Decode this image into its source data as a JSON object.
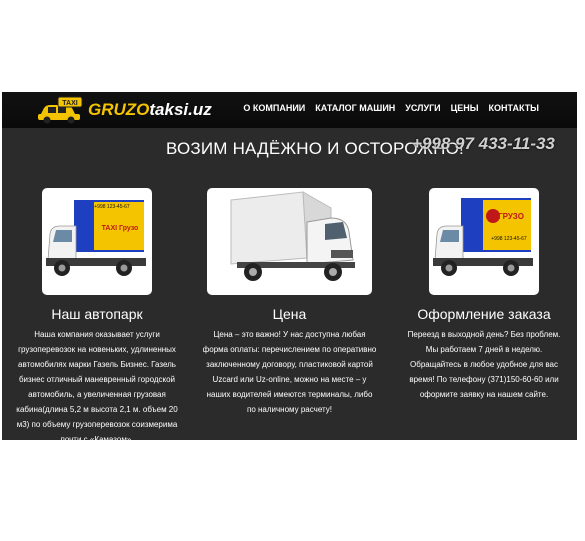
{
  "header": {
    "logo_badge": "TAXI",
    "brand_part1": "GRUZO",
    "brand_part2": "taksi.uz",
    "nav": [
      "О КОМПАНИИ",
      "КАТАЛОГ МАШИН",
      "УСЛУГИ",
      "ЦЕНЫ",
      "КОНТАКТЫ"
    ]
  },
  "banner": {
    "headline": "ВОЗИМ НАДЁЖНО И ОСТОРОЖНО!",
    "phone": "+998 97 433-11-33"
  },
  "cards": [
    {
      "title": "Наш автопарк",
      "body": "Наша компания оказывает услуги грузоперевозок на новеньких, удлиненных автомобилях марки Газель Бизнес. Газель бизнес отличный маневренный городской автомобиль, а увеличенная грузовая кабина(длина 5,2 м высота 2,1 м. объем 20 м3) по объему грузоперевозок соизмерима почти с «Камазом».",
      "image_label": "TAXI Грузо",
      "image_phone": "+998 123-45-67",
      "image_kind": "yellow-gazelle-truck"
    },
    {
      "title": "Цена",
      "body": "Цена – это важно! У нас доступна любая форма оплаты: перечислением по оперативно заключенному договору, пластиковой картой Uzcard или Uz-online, можно на месте – у наших водителей имеются терминалы, либо по наличному расчету!",
      "image_kind": "white-box-truck"
    },
    {
      "title": "Оформление заказа",
      "body": "Переезд в выходной день? Без проблем. Мы работаем 7 дней в неделю. Обращайтесь в любое удобное для вас время! По телефону (371)150-60-60 или оформите заявку на нашем сайте.",
      "image_label": "ГРУЗО",
      "image_phone": "+998 123-45-67",
      "image_kind": "yellow-gazelle-truck"
    }
  ],
  "colors": {
    "topbar": "#0a0a0a",
    "content_bg": "#2b2b2b",
    "accent_yellow": "#f5c400",
    "text": "#ffffff"
  }
}
